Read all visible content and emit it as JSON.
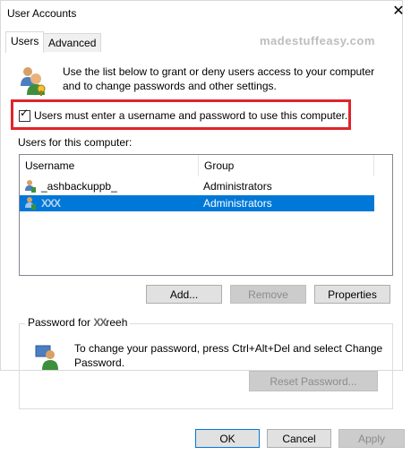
{
  "window": {
    "title": "User Accounts",
    "close_glyph": "✕",
    "watermark": "madestuffeasy.com"
  },
  "tabs": [
    {
      "label": "Users",
      "active": true
    },
    {
      "label": "Advanced",
      "active": false
    }
  ],
  "intro": {
    "icon": "users-icon",
    "text": "Use the list below to grant or deny users access to your computer and to change passwords and other settings."
  },
  "require_login": {
    "checked": true,
    "check_glyph": "✓",
    "label": "Users must enter a username and password to use this computer."
  },
  "users_section": {
    "label": "Users for this computer:",
    "columns": [
      "Username",
      "Group"
    ],
    "rows": [
      {
        "username": "_ashbackuppb_",
        "group": "Administrators",
        "selected": false
      },
      {
        "username": "XXX",
        "group": "Administrators",
        "selected": true
      }
    ]
  },
  "list_buttons": {
    "add": "Add...",
    "remove": "Remove",
    "properties": "Properties"
  },
  "password_group": {
    "title_prefix": "Password for ",
    "title_user_overlay": "XX",
    "title_user_tail": "reeh",
    "icon": "password-user-icon",
    "text": "To change your password, press Ctrl+Alt+Del and select Change Password.",
    "reset_button": "Reset Password..."
  },
  "footer": {
    "ok": "OK",
    "cancel": "Cancel",
    "apply": "Apply"
  },
  "colors": {
    "selection": "#0078d7",
    "highlight_box": "#e0242c",
    "disabled_text": "#8c8c8c"
  }
}
